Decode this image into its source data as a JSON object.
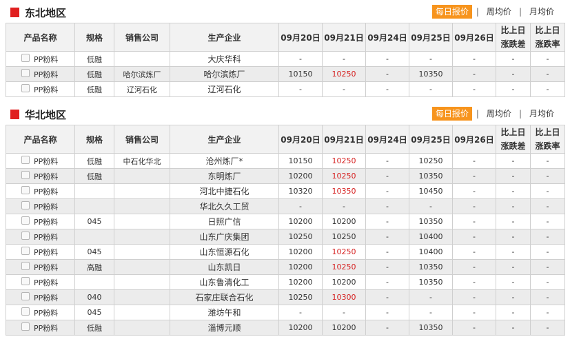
{
  "columns": [
    "产品名称",
    "规格",
    "销售公司",
    "生产企业",
    "09月20日",
    "09月21日",
    "09月24日",
    "09月25日",
    "09月26日",
    [
      "比上日",
      "涨跌差"
    ],
    [
      "比上日",
      "涨跌率"
    ]
  ],
  "tabs": [
    "每日报价",
    "周均价",
    "月均价"
  ],
  "colors": {
    "accent": "#f7941d",
    "marker": "#e02020",
    "up": "#d62020"
  },
  "sections": [
    {
      "title": "东北地区",
      "rows": [
        {
          "product": "PP粉料",
          "spec": "低融",
          "seller": "",
          "producer": "大庆华科",
          "d20": "-",
          "d21": "-",
          "d24": "-",
          "d25": "-",
          "d26": "-",
          "diff": "-",
          "rate": "-"
        },
        {
          "product": "PP粉料",
          "spec": "低融",
          "seller": "哈尔滨炼厂",
          "producer": "哈尔滨炼厂",
          "d20": "10150",
          "d21": "10250",
          "d21_red": true,
          "d24": "-",
          "d25": "10350",
          "d26": "-",
          "diff": "-",
          "rate": "-"
        },
        {
          "product": "PP粉料",
          "spec": "低融",
          "seller": "辽河石化",
          "producer": "辽河石化",
          "d20": "-",
          "d21": "-",
          "d24": "-",
          "d25": "-",
          "d26": "-",
          "diff": "-",
          "rate": "-"
        }
      ]
    },
    {
      "title": "华北地区",
      "rows": [
        {
          "product": "PP粉料",
          "spec": "低融",
          "seller": "中石化华北",
          "producer": "沧州炼厂*",
          "d20": "10150",
          "d21": "10250",
          "d21_red": true,
          "d24": "-",
          "d25": "10250",
          "d26": "-",
          "diff": "-",
          "rate": "-"
        },
        {
          "product": "PP粉料",
          "spec": "低融",
          "seller": "",
          "producer": "东明炼厂",
          "d20": "10200",
          "d21": "10250",
          "d21_red": true,
          "d24": "-",
          "d25": "10350",
          "d26": "-",
          "diff": "-",
          "rate": "-"
        },
        {
          "product": "PP粉料",
          "spec": "",
          "seller": "",
          "producer": "河北中捷石化",
          "d20": "10320",
          "d21": "10350",
          "d21_red": true,
          "d24": "-",
          "d25": "10450",
          "d26": "-",
          "diff": "-",
          "rate": "-"
        },
        {
          "product": "PP粉料",
          "spec": "",
          "seller": "",
          "producer": "华北久久工贸",
          "d20": "-",
          "d21": "-",
          "d24": "-",
          "d25": "-",
          "d26": "-",
          "diff": "-",
          "rate": "-"
        },
        {
          "product": "PP粉料",
          "spec": "045",
          "seller": "",
          "producer": "日照广信",
          "d20": "10200",
          "d21": "10200",
          "d24": "-",
          "d25": "10350",
          "d26": "-",
          "diff": "-",
          "rate": "-"
        },
        {
          "product": "PP粉料",
          "spec": "",
          "seller": "",
          "producer": "山东广庆集团",
          "d20": "10250",
          "d21": "10250",
          "d24": "-",
          "d25": "10400",
          "d26": "-",
          "diff": "-",
          "rate": "-"
        },
        {
          "product": "PP粉料",
          "spec": "045",
          "seller": "",
          "producer": "山东恒源石化",
          "d20": "10200",
          "d21": "10250",
          "d21_red": true,
          "d24": "-",
          "d25": "10400",
          "d26": "-",
          "diff": "-",
          "rate": "-"
        },
        {
          "product": "PP粉料",
          "spec": "高融",
          "seller": "",
          "producer": "山东凯日",
          "d20": "10200",
          "d21": "10250",
          "d21_red": true,
          "d24": "-",
          "d25": "10350",
          "d26": "-",
          "diff": "-",
          "rate": "-"
        },
        {
          "product": "PP粉料",
          "spec": "",
          "seller": "",
          "producer": "山东鲁清化工",
          "d20": "10200",
          "d21": "10200",
          "d24": "-",
          "d25": "10350",
          "d26": "-",
          "diff": "-",
          "rate": "-"
        },
        {
          "product": "PP粉料",
          "spec": "040",
          "seller": "",
          "producer": "石家庄联合石化",
          "d20": "10250",
          "d21": "10300",
          "d21_red": true,
          "d24": "-",
          "d25": "-",
          "d26": "-",
          "diff": "-",
          "rate": "-"
        },
        {
          "product": "PP粉料",
          "spec": "045",
          "seller": "",
          "producer": "潍坊午和",
          "d20": "-",
          "d21": "-",
          "d24": "-",
          "d25": "-",
          "d26": "-",
          "diff": "-",
          "rate": "-"
        },
        {
          "product": "PP粉料",
          "spec": "低融",
          "seller": "",
          "producer": "淄博元顺",
          "d20": "10200",
          "d21": "10200",
          "d24": "-",
          "d25": "10350",
          "d26": "-",
          "diff": "-",
          "rate": "-"
        }
      ]
    }
  ]
}
